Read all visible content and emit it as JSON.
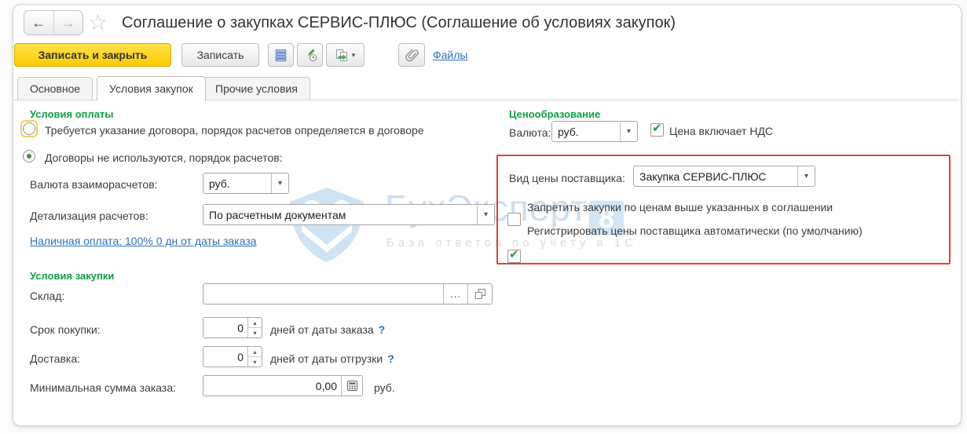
{
  "window": {
    "title": "Соглашение о закупках СЕРВИС-ПЛЮС (Соглашение об условиях закупок)"
  },
  "icons": {
    "back": "←",
    "forward": "→",
    "star": "☆",
    "caret": "▾",
    "spin_up": "▴",
    "spin_down": "▾",
    "ellipsis": "...",
    "help": "?",
    "check": "✔"
  },
  "toolbar": {
    "save_close_label": "Записать и закрыть",
    "save_label": "Записать",
    "files_link": "Файлы",
    "icon_names": [
      "register-records-icon",
      "edit-history-icon",
      "create-based-on-icon",
      "paperclip-icon"
    ]
  },
  "tabs": [
    {
      "label": "Основное",
      "active": false
    },
    {
      "label": "Условия закупок",
      "active": true
    },
    {
      "label": "Прочие условия",
      "active": false
    }
  ],
  "payment": {
    "header": "Условия оплаты",
    "radio_contract": {
      "label": "Требуется указание договора, порядок расчетов определяется в договоре",
      "selected": false
    },
    "radio_no_contract": {
      "label": "Договоры не используются, порядок расчетов:",
      "selected": true
    },
    "currency_label": "Валюта взаиморасчетов:",
    "currency_value": "руб.",
    "detail_label": "Детализация расчетов:",
    "detail_value": "По расчетным документам",
    "cash_link": "Наличная оплата: 100% 0 дн от даты заказа"
  },
  "purchase": {
    "header": "Условия закупки",
    "warehouse_label": "Склад:",
    "warehouse_value": "",
    "period_label": "Срок покупки:",
    "period_value": "0",
    "period_suffix": "дней от даты заказа",
    "delivery_label": "Доставка:",
    "delivery_value": "0",
    "delivery_suffix": "дней от даты отгрузки",
    "min_sum_label": "Минимальная сумма заказа:",
    "min_sum_value": "0,00",
    "min_sum_currency": "руб."
  },
  "pricing": {
    "header": "Ценообразование",
    "currency_label": "Валюта:",
    "currency_value": "руб.",
    "vat_checkbox": {
      "label": "Цена включает НДС",
      "checked": true
    },
    "price_type_label": "Вид цены поставщика:",
    "price_type_value": "Закупка СЕРВИС-ПЛЮС",
    "forbid_checkbox": {
      "label": "Запретить закупки по ценам выше указанных в соглашении",
      "checked": false
    },
    "register_checkbox": {
      "label": "Регистрировать цены поставщика автоматически (по умолчанию)",
      "checked": true
    }
  },
  "watermark": {
    "brand": "БухЭксперт",
    "badge": "8",
    "subtitle": "База ответов по учету в 1С"
  },
  "colors": {
    "accent_green": "#0ca044",
    "link_blue": "#2e71b8",
    "button_yellow": "#ffd21e",
    "annotation_red": "#e43d3d",
    "watermark_blue": "#cbdff1"
  }
}
